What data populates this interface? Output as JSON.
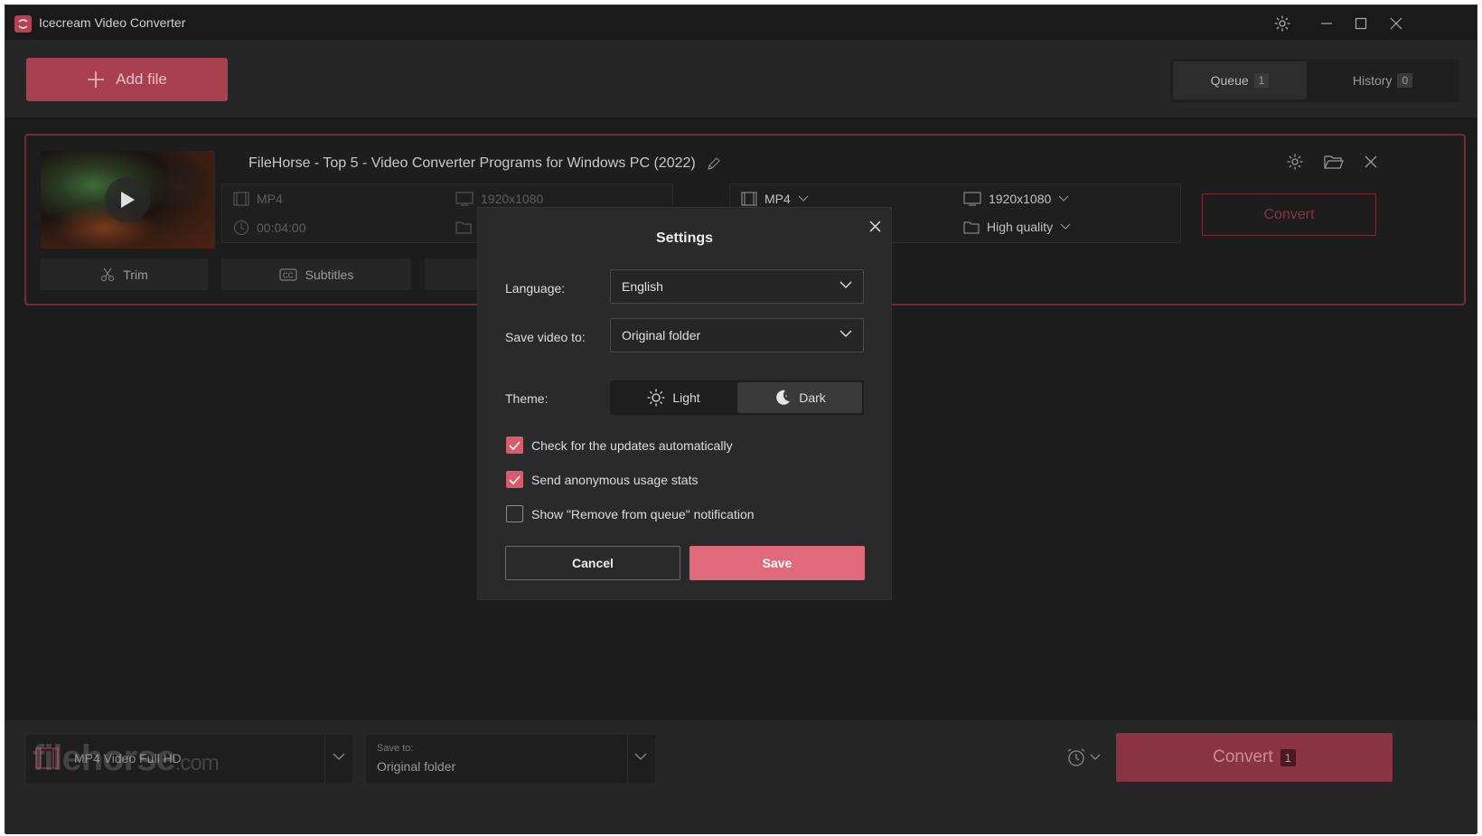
{
  "app": {
    "title": "Icecream Video Converter"
  },
  "header": {
    "add_file_label": "Add file",
    "tabs": [
      {
        "label": "Queue",
        "count": "1"
      },
      {
        "label": "History",
        "count": "0"
      }
    ]
  },
  "queue_item": {
    "title": "FileHorse - Top 5 - Video Converter Programs for Windows PC (2022)",
    "source": {
      "format": "MP4",
      "resolution": "1920x1080",
      "duration": "00:04:00"
    },
    "target": {
      "format": "MP4",
      "resolution": "1920x1080",
      "quality": "High quality"
    },
    "convert_label": "Convert",
    "tools": [
      {
        "label": "Trim"
      },
      {
        "label": "Subtitles"
      }
    ]
  },
  "settings": {
    "title": "Settings",
    "language_label": "Language:",
    "language_value": "English",
    "save_to_label": "Save video to:",
    "save_to_value": "Original folder",
    "theme_label": "Theme:",
    "theme_options": [
      {
        "label": "Light"
      },
      {
        "label": "Dark"
      }
    ],
    "theme_selected": "Dark",
    "checkboxes": [
      {
        "label": "Check for the updates automatically",
        "checked": true
      },
      {
        "label": "Send anonymous usage stats",
        "checked": true
      },
      {
        "label": "Show \"Remove from queue\" notification",
        "checked": false
      }
    ],
    "cancel_label": "Cancel",
    "save_label": "Save"
  },
  "bottom": {
    "profile_value": "MP4 Video Full HD",
    "save_to_caption": "Save to:",
    "save_to_value": "Original folder",
    "convert_label": "Convert",
    "convert_count": "1"
  },
  "watermark": {
    "text": "filehorse",
    "suffix": ".com"
  },
  "colors": {
    "accent": "#e0697b",
    "accent_dark": "#a8404f",
    "background": "#1c1c1c"
  }
}
